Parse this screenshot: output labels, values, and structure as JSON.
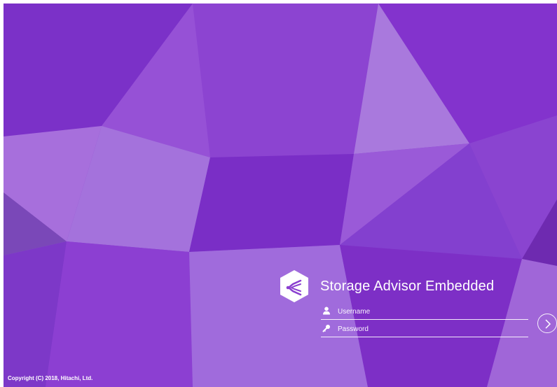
{
  "app": {
    "title": "Storage Advisor Embedded"
  },
  "login": {
    "username_placeholder": "Username",
    "password_placeholder": "Password",
    "username_value": "",
    "password_value": ""
  },
  "icons": {
    "logo": "hitachi-logo-hexagon-icon",
    "username": "user-icon",
    "password": "key-icon",
    "submit": "chevron-right-icon"
  },
  "footer": {
    "copyright": "Copyright (C) 2018, Hitachi, Ltd."
  },
  "colors": {
    "background_primary": "#8a3fd0",
    "text": "#ffffff"
  }
}
